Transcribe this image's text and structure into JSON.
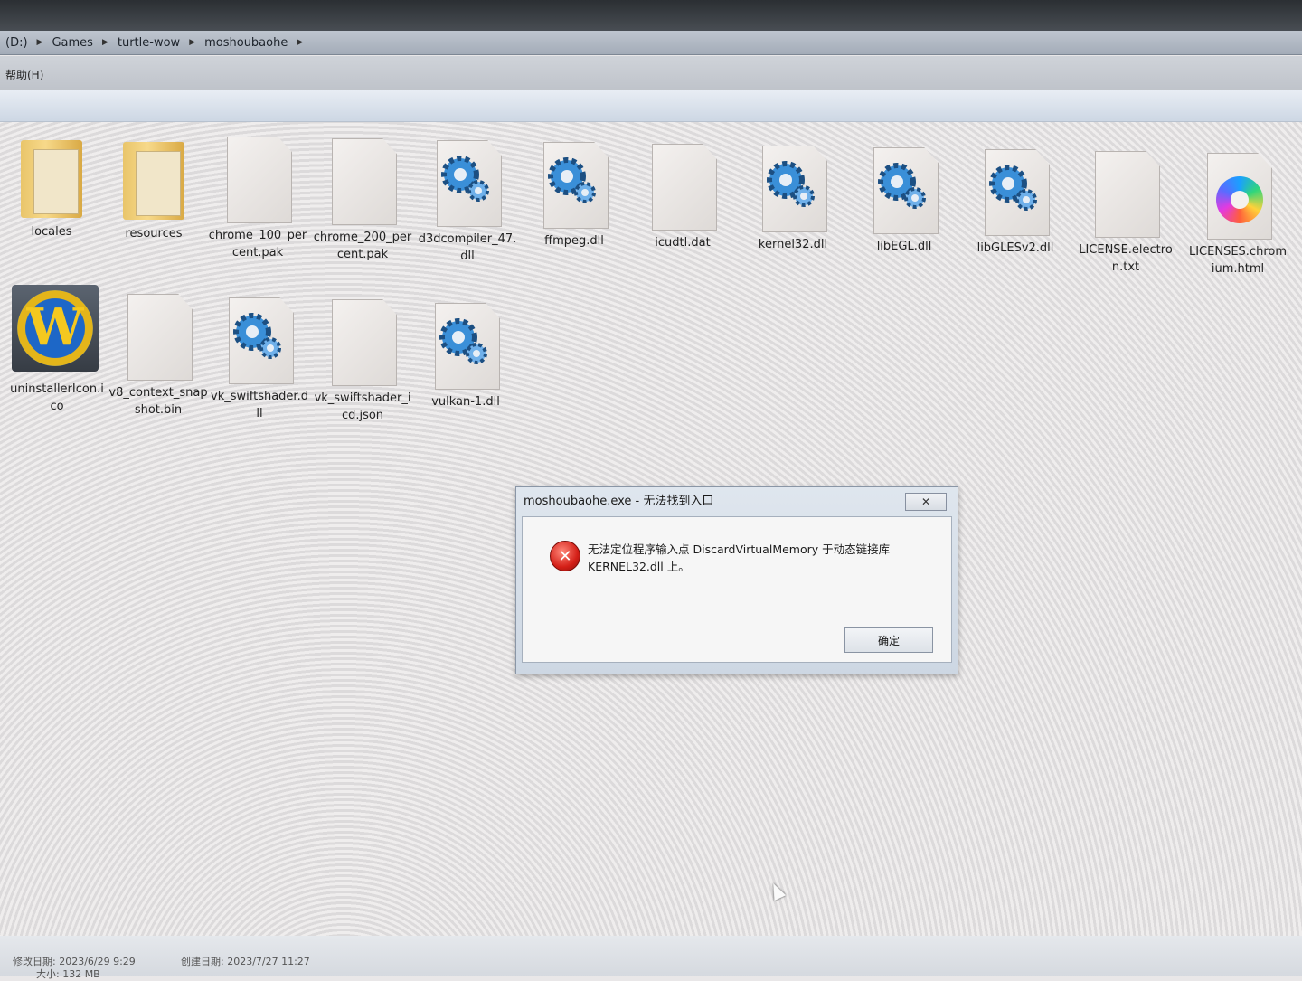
{
  "address": {
    "crumbs": [
      "(D:)",
      "Games",
      "turtle-wow",
      "moshoubaohe"
    ]
  },
  "menu": {
    "help": "帮助(H)"
  },
  "files": [
    {
      "name": "locales",
      "type": "folder"
    },
    {
      "name": "resources",
      "type": "folder"
    },
    {
      "name": "chrome_100_percent.pak",
      "type": "document"
    },
    {
      "name": "chrome_200_percent.pak",
      "type": "document"
    },
    {
      "name": "d3dcompiler_47.dll",
      "type": "gear"
    },
    {
      "name": "ffmpeg.dll",
      "type": "gear"
    },
    {
      "name": "icudtl.dat",
      "type": "document"
    },
    {
      "name": "kernel32.dll",
      "type": "gear"
    },
    {
      "name": "libEGL.dll",
      "type": "gear"
    },
    {
      "name": "libGLESv2.dll",
      "type": "gear"
    },
    {
      "name": "LICENSE.electron.txt",
      "type": "text"
    },
    {
      "name": "LICENSES.chromium.html",
      "type": "chromium"
    },
    {
      "name": "uninstallerIcon.ico",
      "type": "wow"
    },
    {
      "name": "v8_context_snapshot.bin",
      "type": "document"
    },
    {
      "name": "vk_swiftshader.dll",
      "type": "gear"
    },
    {
      "name": "vk_swiftshader_icd.json",
      "type": "document"
    },
    {
      "name": "vulkan-1.dll",
      "type": "gear"
    }
  ],
  "dialog": {
    "title": "moshoubaohe.exe - 无法找到入口",
    "close": "✕",
    "message_line1": "无法定位程序输入点 DiscardVirtualMemory 于动态链接库",
    "message_line2": "KERNEL32.dll 上。",
    "ok": "确定"
  },
  "status": {
    "modified": "修改日期: 2023/6/29 9:29",
    "created": "创建日期: 2023/7/27 11:27",
    "size": "大小: 132 MB"
  },
  "colors": {
    "error_red": "#d41f17",
    "dialog_frame": "#cdd7e3"
  }
}
